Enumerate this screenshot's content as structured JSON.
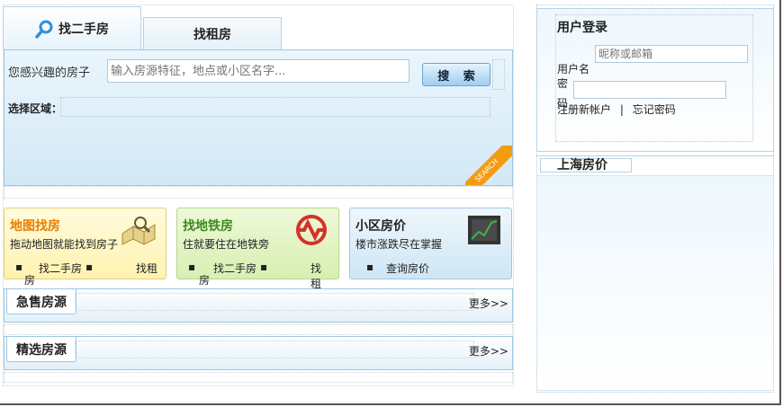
{
  "search": {
    "tabs": [
      {
        "label": "找二手房",
        "active": true,
        "icon": "search-icon"
      },
      {
        "label": "找租房",
        "active": false
      }
    ],
    "label": "您感兴趣的房子",
    "placeholder": "输入房源特征，地点或小区名字...",
    "button": "搜 索",
    "region_label": "选择区域：",
    "ribbon": "SEARCH"
  },
  "cards": [
    {
      "title": "地图找房",
      "desc": "拖动地图就能找到房子",
      "links": [
        "房",
        "找二手房",
        "找租"
      ],
      "icon": "map-icon"
    },
    {
      "title": "找地铁房",
      "desc": "住就要住在地铁旁",
      "links": [
        "房",
        "找二手房",
        "找租"
      ],
      "icon": "metro-icon"
    },
    {
      "title": "小区房价",
      "desc": "楼市涨跌尽在掌握",
      "links": [
        "查询房价"
      ],
      "icon": "chart-icon"
    }
  ],
  "sections": [
    {
      "title": "急售房源",
      "more": "更多>>"
    },
    {
      "title": "精选房源",
      "more": "更多>>"
    }
  ],
  "login": {
    "title": "用户登录",
    "username_label": "用户名",
    "username_placeholder": "昵称或邮箱",
    "password_label": "密码",
    "register": "注册新帐户",
    "separator": "|",
    "forgot": "忘记密码"
  },
  "price": {
    "title": "上海房价"
  },
  "colors": {
    "accent": "#f39c12",
    "border": "#9fc7e2",
    "map": "#e87d00",
    "metro": "#3b8b1a"
  }
}
